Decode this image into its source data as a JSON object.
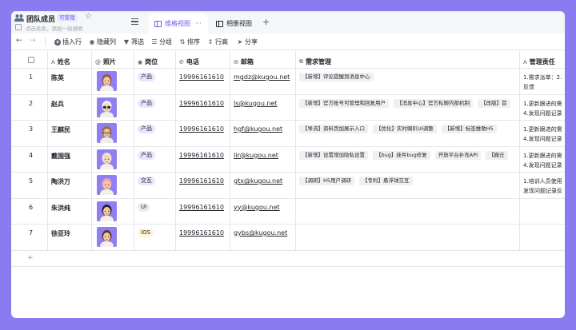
{
  "doc": {
    "title": "团队成员",
    "edit_badge": "可管理",
    "description": "点击此处，添加一段说明"
  },
  "tabs": [
    {
      "label": "维格视图",
      "more": "···",
      "active": true
    },
    {
      "label": "相册视图",
      "active": false
    }
  ],
  "toolbar": {
    "insert_row": "插入行",
    "hide_columns": "隐藏列",
    "filter": "筛选",
    "group": "分组",
    "sort": "排序",
    "row_height": "行高",
    "share": "分享"
  },
  "columns": {
    "name": "姓名",
    "photo": "照片",
    "role": "岗位",
    "phone": "电话",
    "email": "邮箱",
    "requirements": "需求管理",
    "management": "管理责任"
  },
  "colors": {
    "accent": "#6f5cf2",
    "background": "#8a7cf0",
    "tag_product_bg": "#e8e5ff",
    "tag_interaction_bg": "#e8e5ff",
    "tag_ui_bg": "#e6edf5",
    "tag_ios_bg": "#fff3d6"
  },
  "rows": [
    {
      "index": "1",
      "name": "陈英",
      "avatar": "avatar-bald",
      "role": "产品",
      "role_color": "#e8e5ff",
      "phone": "19996161610",
      "email": "mgdz@kugou.net",
      "requirements": [
        "【新增】评论提醒到消息中心"
      ],
      "management": [
        "1.需求派单：2.",
        "反馈"
      ]
    },
    {
      "index": "2",
      "name": "赵兵",
      "avatar": "avatar-sunglasses",
      "role": "产品",
      "role_color": "#e8e5ff",
      "phone": "19996161610",
      "email": "ls@kugou.net",
      "requirements": [
        "【新增】官方账号可管理和回复用户",
        "【消息中心】官方私聊内部机制",
        "【改版】首"
      ],
      "management": [
        "1.更新跟进的需",
        "4.发现问题记录"
      ]
    },
    {
      "index": "3",
      "name": "王麒民",
      "avatar": "avatar-glasses",
      "role": "产品",
      "role_color": "#e8e5ff",
      "phone": "19996161610",
      "email": "hgf@kugou.net",
      "requirements": [
        "【导流】资料页加展示入口",
        "【优化】实时喇叭UI调整",
        "【新增】标签推歌H5"
      ],
      "management": [
        "1.更新跟进的需",
        "4.发现问题记录"
      ]
    },
    {
      "index": "4",
      "name": "戴国强",
      "avatar": "avatar-blonde",
      "role": "产品",
      "role_color": "#e8e5ff",
      "phone": "19996161610",
      "email": "lir@kugou.net",
      "requirements": [
        "【新增】设置增加隐私设置",
        "【bug】挂件bug修复",
        "开放平台补充API",
        "【搬迁"
      ],
      "management": [
        "1.更新跟进的需",
        "4.发现问题记录"
      ]
    },
    {
      "index": "5",
      "name": "陶洪万",
      "avatar": "avatar-pink",
      "role": "交互",
      "role_color": "#e8e5ff",
      "phone": "19996161610",
      "email": "gtx@kugou.net",
      "requirements": [
        "【调研】H5用户调研",
        "【专利】悬浮球交互"
      ],
      "management": [
        "1.培训人员使用",
        "发现问题记录反"
      ]
    },
    {
      "index": "6",
      "name": "朱洪纯",
      "avatar": "avatar-curly",
      "role": "UI",
      "role_color": "#e6edf5",
      "phone": "19996161610",
      "email": "yy@kugou.net",
      "requirements": [],
      "management": []
    },
    {
      "index": "7",
      "name": "徐亚玲",
      "avatar": "avatar-brown",
      "role": "iOS",
      "role_color": "#fff3d6",
      "phone": "19996161610",
      "email": "gybs@kugou.net",
      "requirements": [],
      "management": []
    }
  ],
  "add_row_label": "+"
}
